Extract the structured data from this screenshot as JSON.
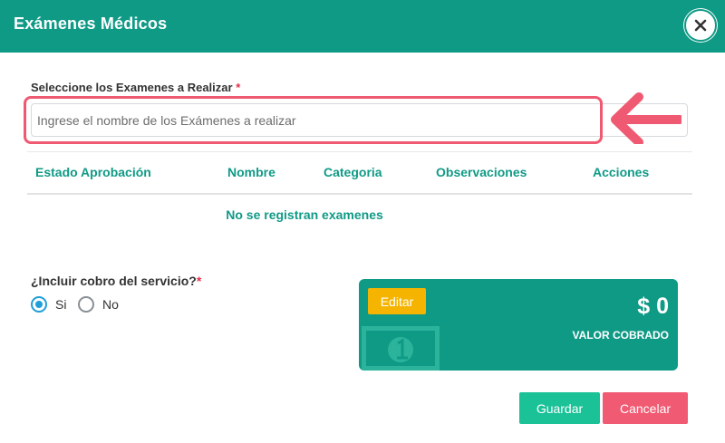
{
  "modal": {
    "title": "Exámenes Médicos",
    "close_icon": "close-icon"
  },
  "exam_search": {
    "label": "Seleccione los Examenes a Realizar",
    "required_mark": "*",
    "value": "",
    "placeholder": "Ingrese el nombre de los Exámenes a realizar"
  },
  "table": {
    "columns": [
      "Estado Aprobación",
      "Nombre",
      "Categoria",
      "Observaciones",
      "Acciones"
    ],
    "empty_message": "No se registran examenes"
  },
  "charge": {
    "label": "¿Incluir cobro del servicio?",
    "required_mark": "*",
    "options": [
      {
        "label": "Si",
        "selected": true
      },
      {
        "label": "No",
        "selected": false
      }
    ]
  },
  "payment_card": {
    "edit_label": "Editar",
    "amount": "$ 0",
    "caption": "VALOR COBRADO",
    "icon": "money-bill-icon"
  },
  "footer": {
    "save_label": "Guardar",
    "cancel_label": "Cancelar"
  },
  "colors": {
    "primary": "#0f9a86",
    "accent_text": "#109a86",
    "warning": "#f4b400",
    "success": "#1bc298",
    "danger": "#f05a72",
    "annotation": "#ef5a72",
    "radio_checked": "#1f9fd8"
  }
}
